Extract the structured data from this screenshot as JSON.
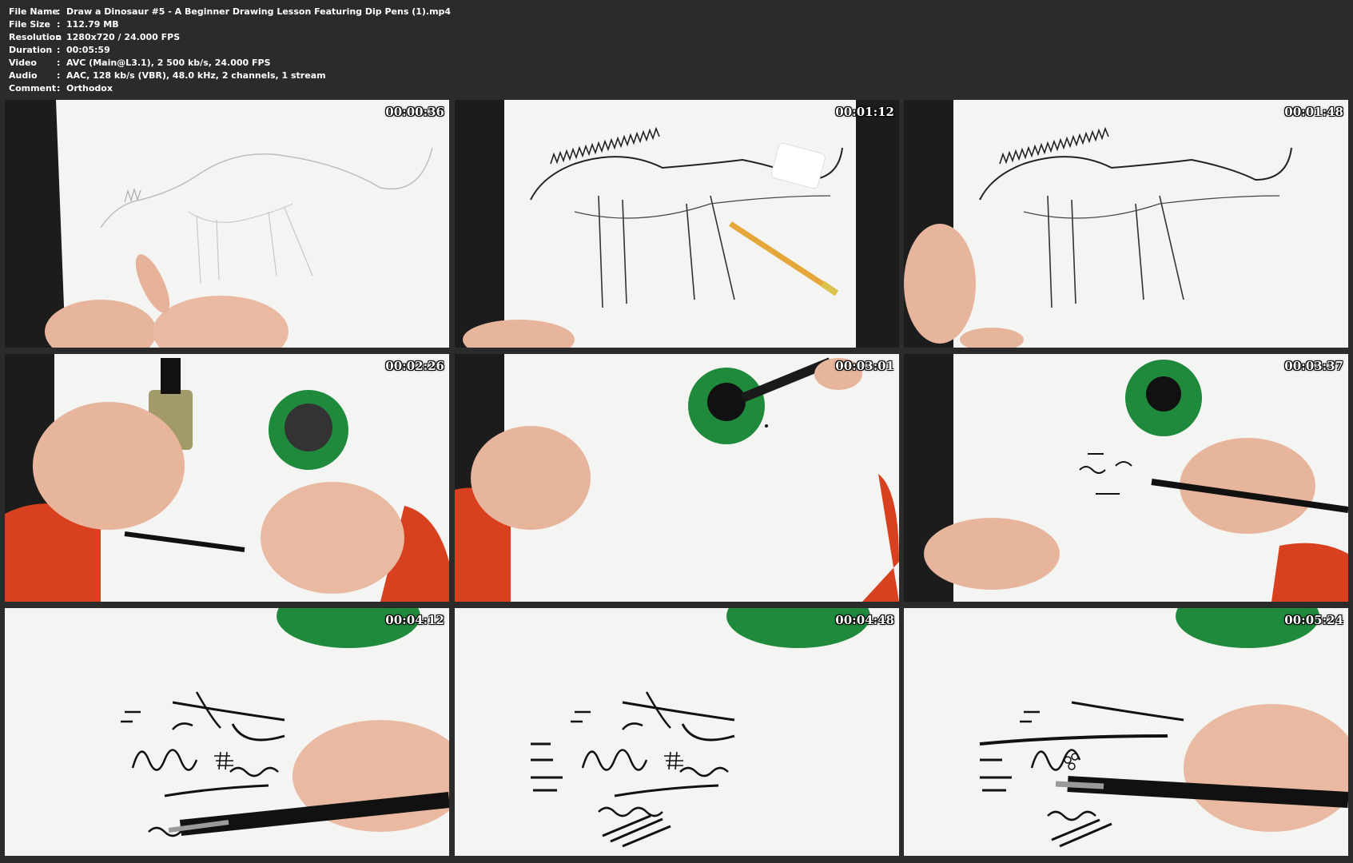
{
  "info": {
    "rows": [
      {
        "key": "File Name",
        "value": "Draw a Dinosaur #5 - A Beginner Drawing Lesson Featuring Dip Pens (1).mp4"
      },
      {
        "key": "File Size",
        "value": "112.79 MB"
      },
      {
        "key": "Resolution",
        "value": "1280x720 / 24.000 FPS"
      },
      {
        "key": "Duration",
        "value": "00:05:59"
      },
      {
        "key": "Video",
        "value": "AVC (Main@L3.1), 2 500 kb/s, 24.000 FPS"
      },
      {
        "key": "Audio",
        "value": "AAC, 128 kb/s (VBR), 48.0 kHz, 2 channels, 1 stream"
      },
      {
        "key": "Comment",
        "value": "Orthodox"
      }
    ],
    "separator": ":"
  },
  "thumbnails": [
    {
      "time": "00:00:36"
    },
    {
      "time": "00:01:12"
    },
    {
      "time": "00:01:48"
    },
    {
      "time": "00:02:26"
    },
    {
      "time": "00:03:01"
    },
    {
      "time": "00:03:37"
    },
    {
      "time": "00:04:12"
    },
    {
      "time": "00:04:48"
    },
    {
      "time": "00:05:24"
    }
  ],
  "colors": {
    "background": "#2b2b2b",
    "paper": "#f7f7f7",
    "ink": "#111111",
    "ink_jar": "#1f8a3c",
    "skin": "#e9b8a0",
    "jacket": "#d8401f"
  }
}
